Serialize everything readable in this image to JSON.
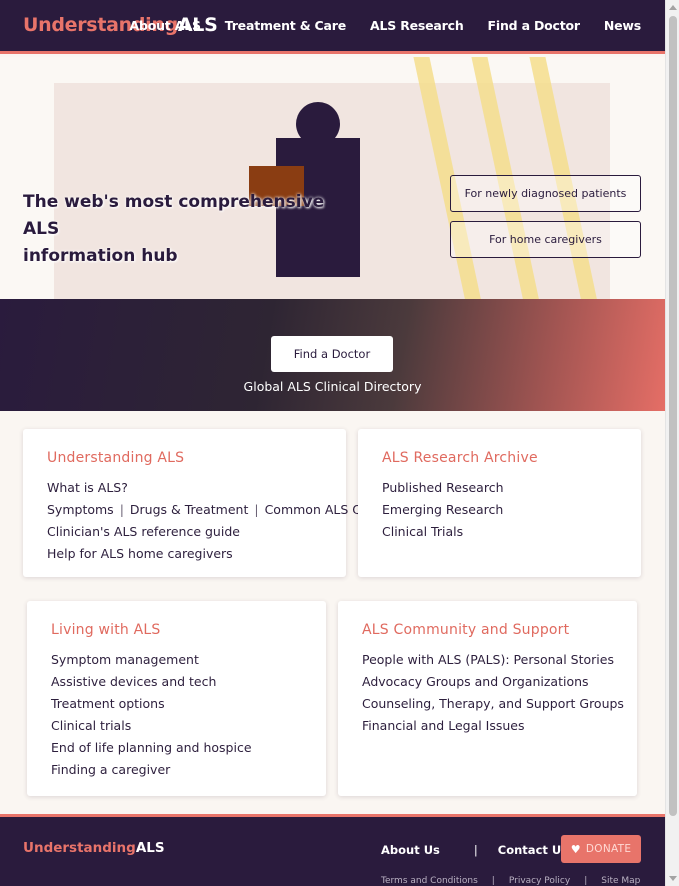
{
  "brand": {
    "part1": "Understanding",
    "part2": "ALS"
  },
  "nav": [
    "About ALS",
    "Treatment & Care",
    "ALS Research",
    "Find a Doctor",
    "News"
  ],
  "hero": {
    "title_line1": "The web's most comprehensive ALS",
    "title_line2": "information hub",
    "pill1": "For newly diagnosed patients",
    "pill2": "For home caregivers"
  },
  "find": {
    "button": "Find a Doctor",
    "subtitle": "Global ALS Clinical Directory"
  },
  "cards": {
    "understanding": {
      "title": "Understanding ALS",
      "items": [
        "What is ALS?",
        "Clinician's ALS reference guide",
        "Help for ALS home caregivers"
      ],
      "sublinks": [
        "Symptoms",
        "Drugs & Treatment",
        "Common ALS Questions"
      ]
    },
    "research": {
      "title": "ALS Research Archive",
      "items": [
        "Published Research",
        "Emerging Research",
        "Clinical Trials"
      ]
    },
    "living": {
      "title": "Living with ALS",
      "items": [
        "Symptom management",
        "Assistive devices and tech",
        "Treatment options",
        "Clinical trials",
        "End of life planning and hospice",
        "Finding a caregiver"
      ]
    },
    "community": {
      "title": "ALS Community and Support",
      "items": [
        "People with ALS (PALS): Personal Stories",
        "Advocacy Groups and Organizations",
        "Counseling, Therapy, and Support Groups",
        "Financial and Legal Issues"
      ]
    }
  },
  "footer": {
    "about": "About Us",
    "pipe": "|",
    "contact": "Contact Us",
    "donate": "DONATE",
    "small": [
      "Terms and Conditions",
      "Privacy Policy",
      "Site Map"
    ]
  },
  "colors": {
    "brand_dark": "#2a1b3d",
    "accent": "#e8746a"
  }
}
